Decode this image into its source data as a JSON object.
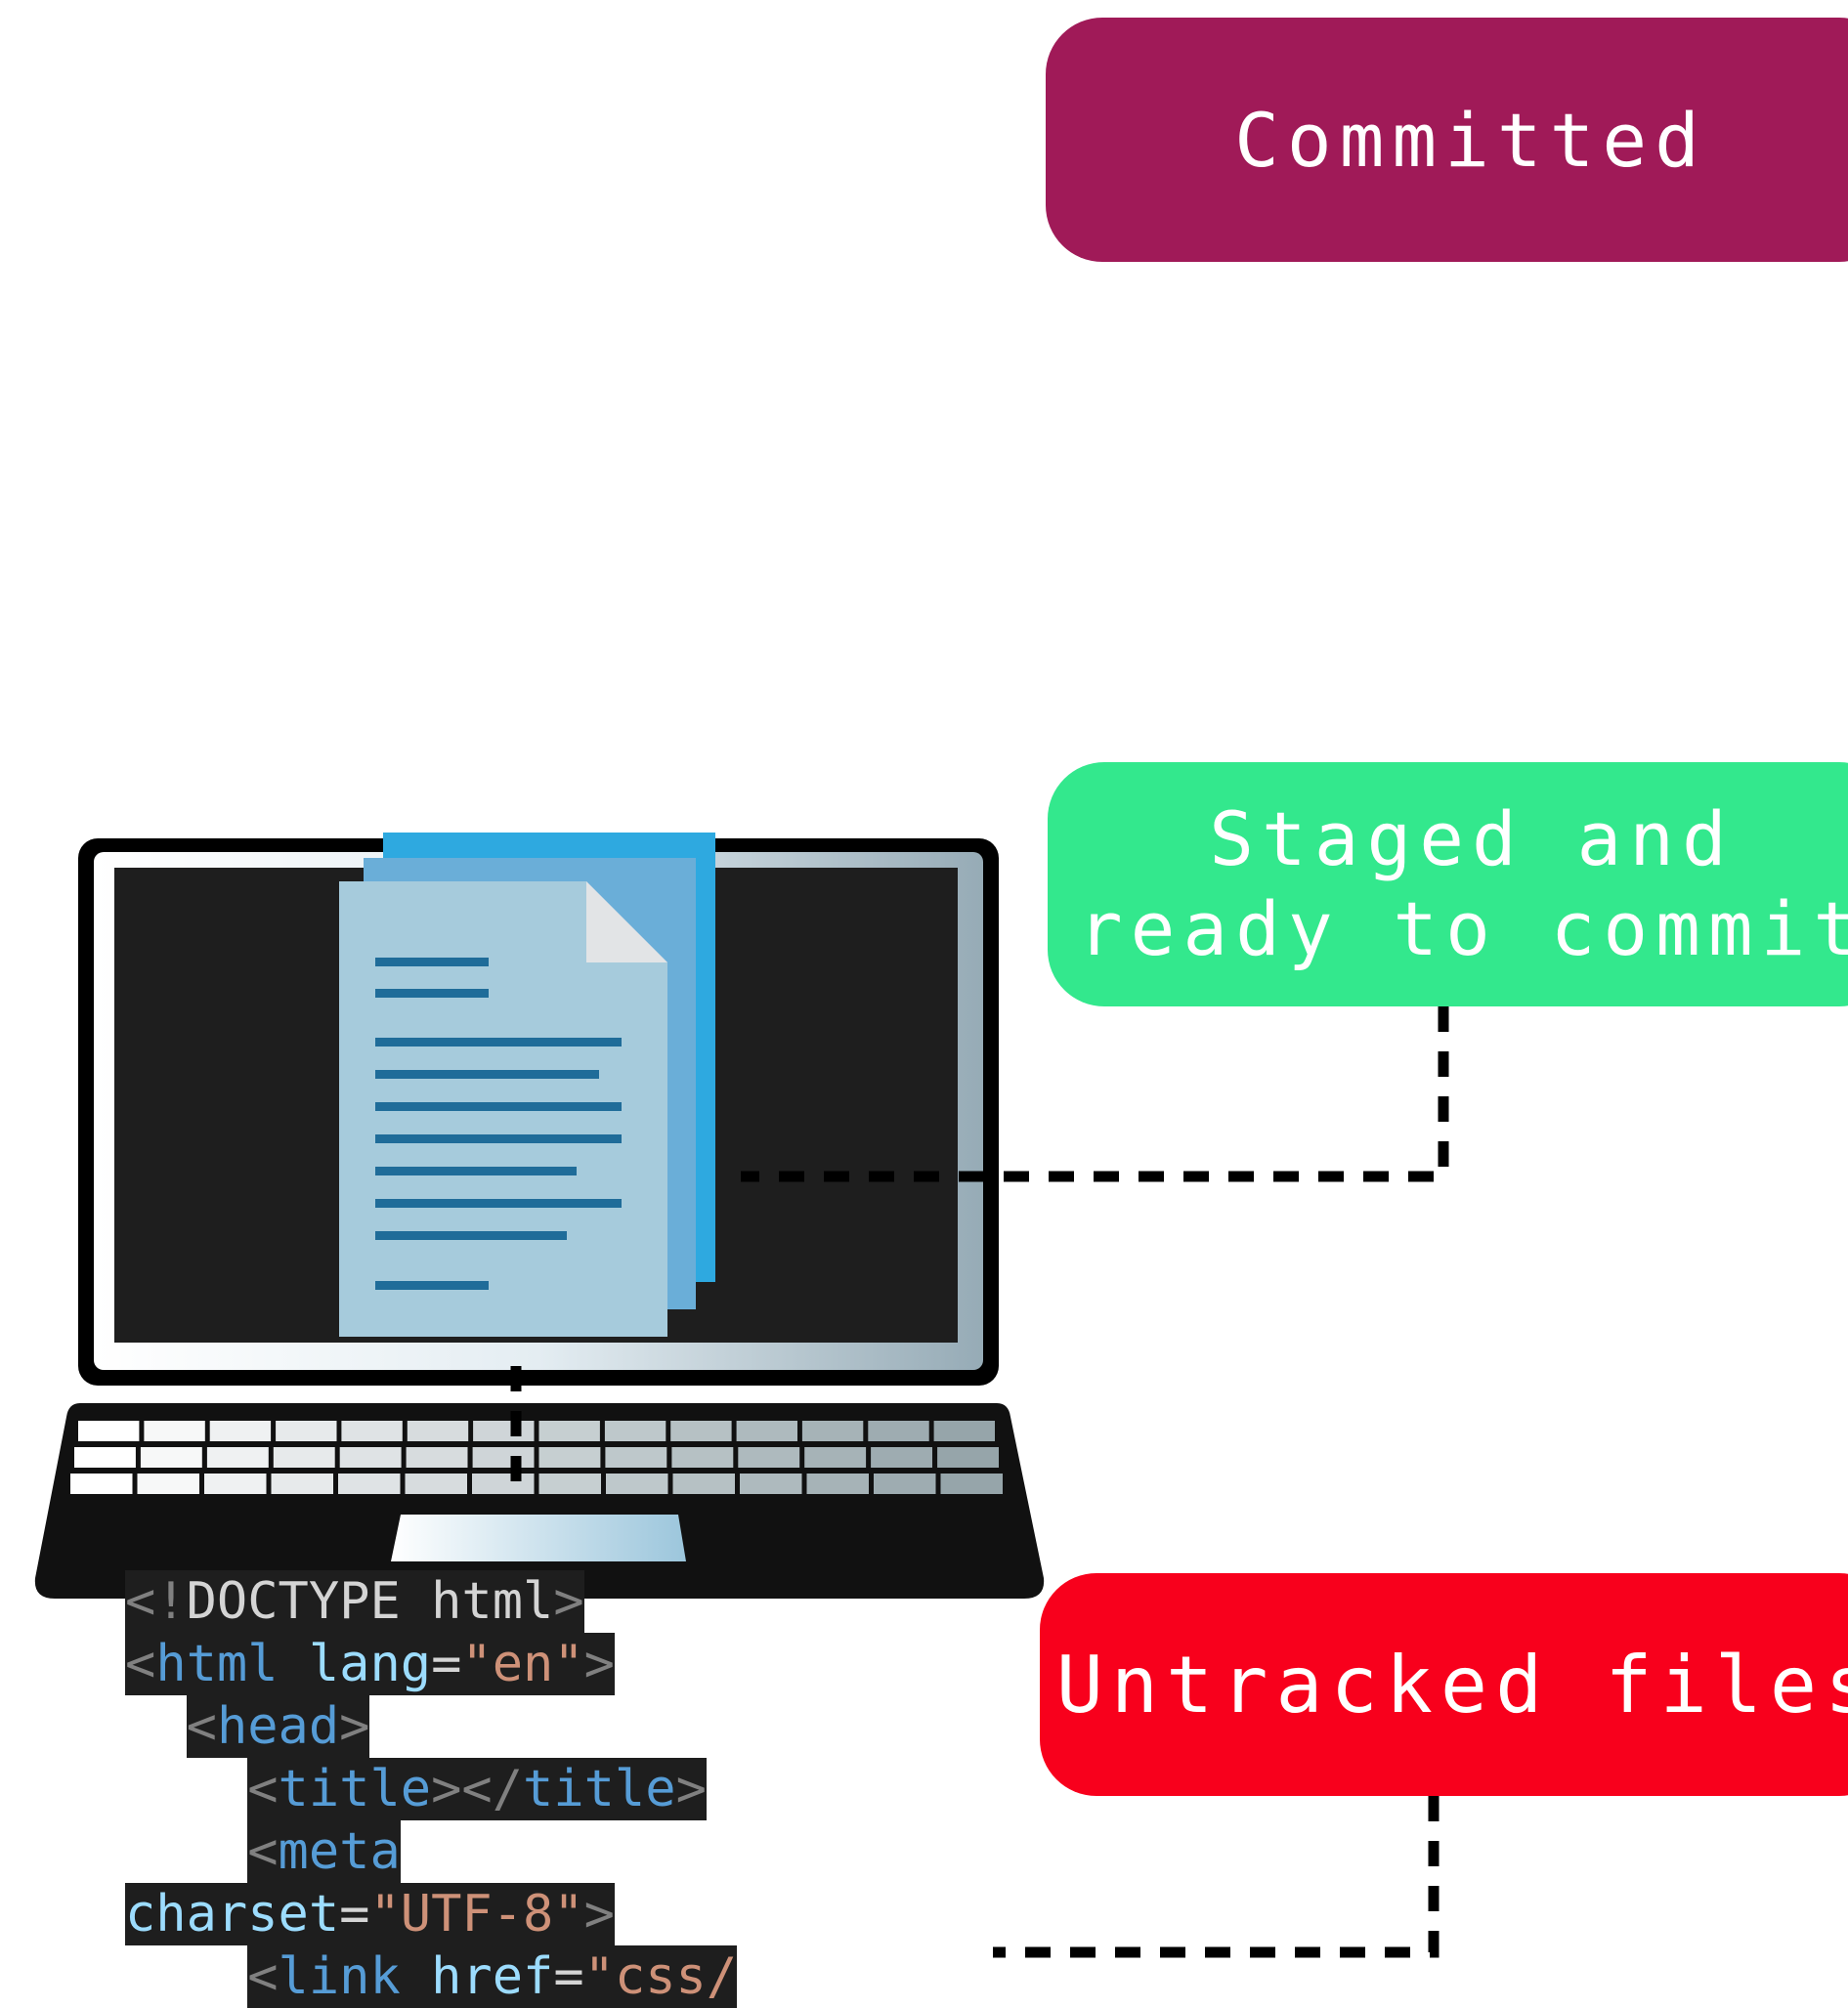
{
  "colors": {
    "committed": "#a01a58",
    "staged": "#33e88d",
    "untracked": "#f8001c",
    "connector": "#000000",
    "screen": "#1e1e1e",
    "document_light": "#a6cbdc",
    "document_mid": "#6aaed8",
    "document_back": "#2ea9e0",
    "document_lines": "#1f6c99"
  },
  "states": {
    "committed": {
      "label": "Committed"
    },
    "staged": {
      "line1": "Staged and",
      "line2": "ready to commit"
    },
    "untracked": {
      "label": "Untracked files"
    }
  },
  "icons": [
    "laptop-icon",
    "document-stack-icon"
  ],
  "code": {
    "lines": [
      {
        "indent": "",
        "parts": [
          [
            "<!",
            "gray"
          ],
          [
            "DOCTYPE html",
            "text"
          ],
          [
            ">",
            "gray"
          ]
        ]
      },
      {
        "indent": "",
        "parts": [
          [
            "<",
            "gray"
          ],
          [
            "html",
            "blue"
          ],
          [
            " ",
            "text"
          ],
          [
            "lang",
            "attr"
          ],
          [
            "=",
            "text"
          ],
          [
            "\"en\"",
            "str"
          ],
          [
            ">",
            "gray"
          ]
        ]
      },
      {
        "indent": "  ",
        "parts": [
          [
            "<",
            "gray"
          ],
          [
            "head",
            "blue"
          ],
          [
            ">",
            "gray"
          ]
        ]
      },
      {
        "indent": "    ",
        "parts": [
          [
            "<",
            "gray"
          ],
          [
            "title",
            "blue"
          ],
          [
            "></",
            "gray"
          ],
          [
            "title",
            "blue"
          ],
          [
            ">",
            "gray"
          ]
        ]
      },
      {
        "indent": "    ",
        "parts": [
          [
            "<",
            "gray"
          ],
          [
            "meta",
            "blue"
          ]
        ]
      },
      {
        "indent": "",
        "parts": [
          [
            "charset",
            "attr"
          ],
          [
            "=",
            "text"
          ],
          [
            "\"UTF-8\"",
            "str"
          ],
          [
            ">",
            "gray"
          ]
        ]
      },
      {
        "indent": "    ",
        "parts": [
          [
            "<",
            "gray"
          ],
          [
            "link",
            "blue"
          ],
          [
            " ",
            "text"
          ],
          [
            "href",
            "attr"
          ],
          [
            "=",
            "text"
          ],
          [
            "\"css/",
            "str"
          ]
        ]
      }
    ]
  }
}
